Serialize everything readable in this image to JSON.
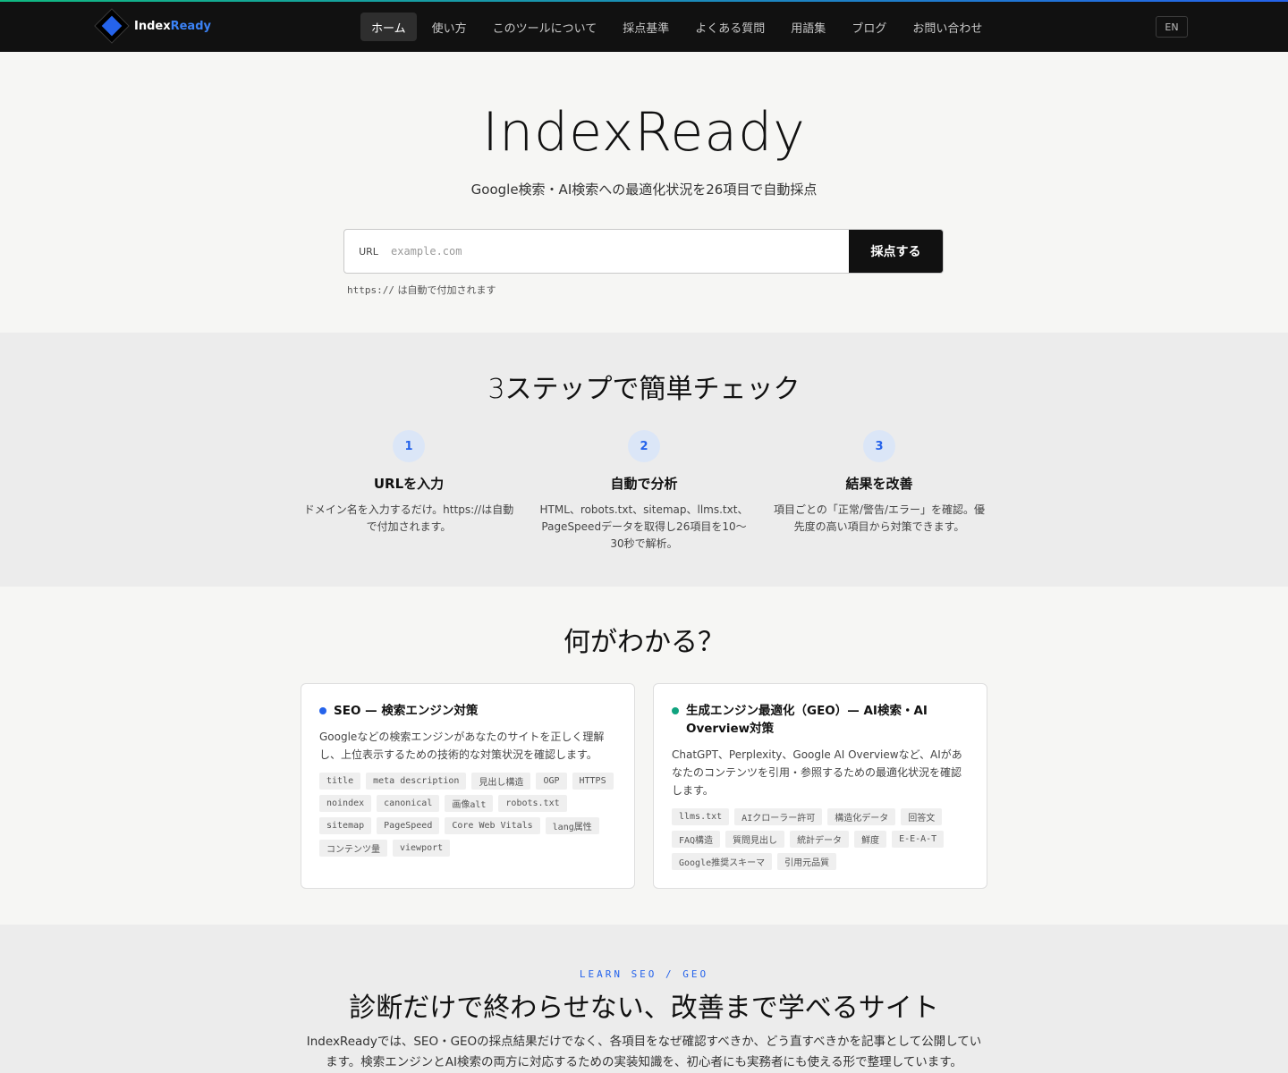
{
  "brand": {
    "name_part1": "Index",
    "name_part2": "Ready"
  },
  "nav": {
    "items": [
      {
        "label": "ホーム"
      },
      {
        "label": "使い方"
      },
      {
        "label": "このツールについて"
      },
      {
        "label": "採点基準"
      },
      {
        "label": "よくある質問"
      },
      {
        "label": "用語集"
      },
      {
        "label": "ブログ"
      },
      {
        "label": "お問い合わせ"
      }
    ],
    "active_index": 0,
    "lang_button": "EN"
  },
  "hero": {
    "title": "IndexReady",
    "subtitle": "Google検索・AI検索への最適化状況を26項目で自動採点",
    "url_label": "URL",
    "url_placeholder": "example.com",
    "submit_label": "採点する",
    "hint_mono": "https://",
    "hint_text": " は自動で付加されます"
  },
  "steps": {
    "title": "3ステップで簡単チェック",
    "items": [
      {
        "num": "1",
        "title": "URLを入力",
        "desc": "ドメイン名を入力するだけ。https://は自動で付加されます。"
      },
      {
        "num": "2",
        "title": "自動で分析",
        "desc": "HTML、robots.txt、sitemap、llms.txt、PageSpeedデータを取得し26項目を10〜30秒で解析。"
      },
      {
        "num": "3",
        "title": "結果を改善",
        "desc": "項目ごとの「正常/警告/エラー」を確認。優先度の高い項目から対策できます。"
      }
    ]
  },
  "features": {
    "title": "何がわかる？",
    "cards": [
      {
        "title": "SEO — 検索エンジン対策",
        "desc": "Googleなどの検索エンジンがあなたのサイトを正しく理解し、上位表示するための技術的な対策状況を確認します。",
        "dot_color": "#2563eb",
        "tags": [
          "title",
          "meta description",
          "見出し構造",
          "OGP",
          "HTTPS",
          "noindex",
          "canonical",
          "画像alt",
          "robots.txt",
          "sitemap",
          "PageSpeed",
          "Core Web Vitals",
          "lang属性",
          "コンテンツ量",
          "viewport"
        ]
      },
      {
        "title": "生成エンジン最適化（GEO）— AI検索・AI Overview対策",
        "desc": "ChatGPT、Perplexity、Google AI Overviewなど、AIがあなたのコンテンツを引用・参照するための最適化状況を確認します。",
        "dot_color": "#10a37f",
        "tags": [
          "llms.txt",
          "AIクローラー許可",
          "構造化データ",
          "回答文",
          "FAQ構造",
          "質問見出し",
          "統計データ",
          "鮮度",
          "E-E-A-T",
          "Google推奨スキーマ",
          "引用元品質"
        ]
      }
    ]
  },
  "learn": {
    "kicker": "LEARN SEO / GEO",
    "title": "診断だけで終わらせない、改善まで学べるサイト",
    "desc": "IndexReadyでは、SEO・GEOの採点結果だけでなく、各項目をなぜ確認すべきか、どう直すべきかを記事として公開しています。検索エンジンとAI検索の両方に対応するための実装知識を、初心者にも実務者にも使える形で整理しています。"
  }
}
